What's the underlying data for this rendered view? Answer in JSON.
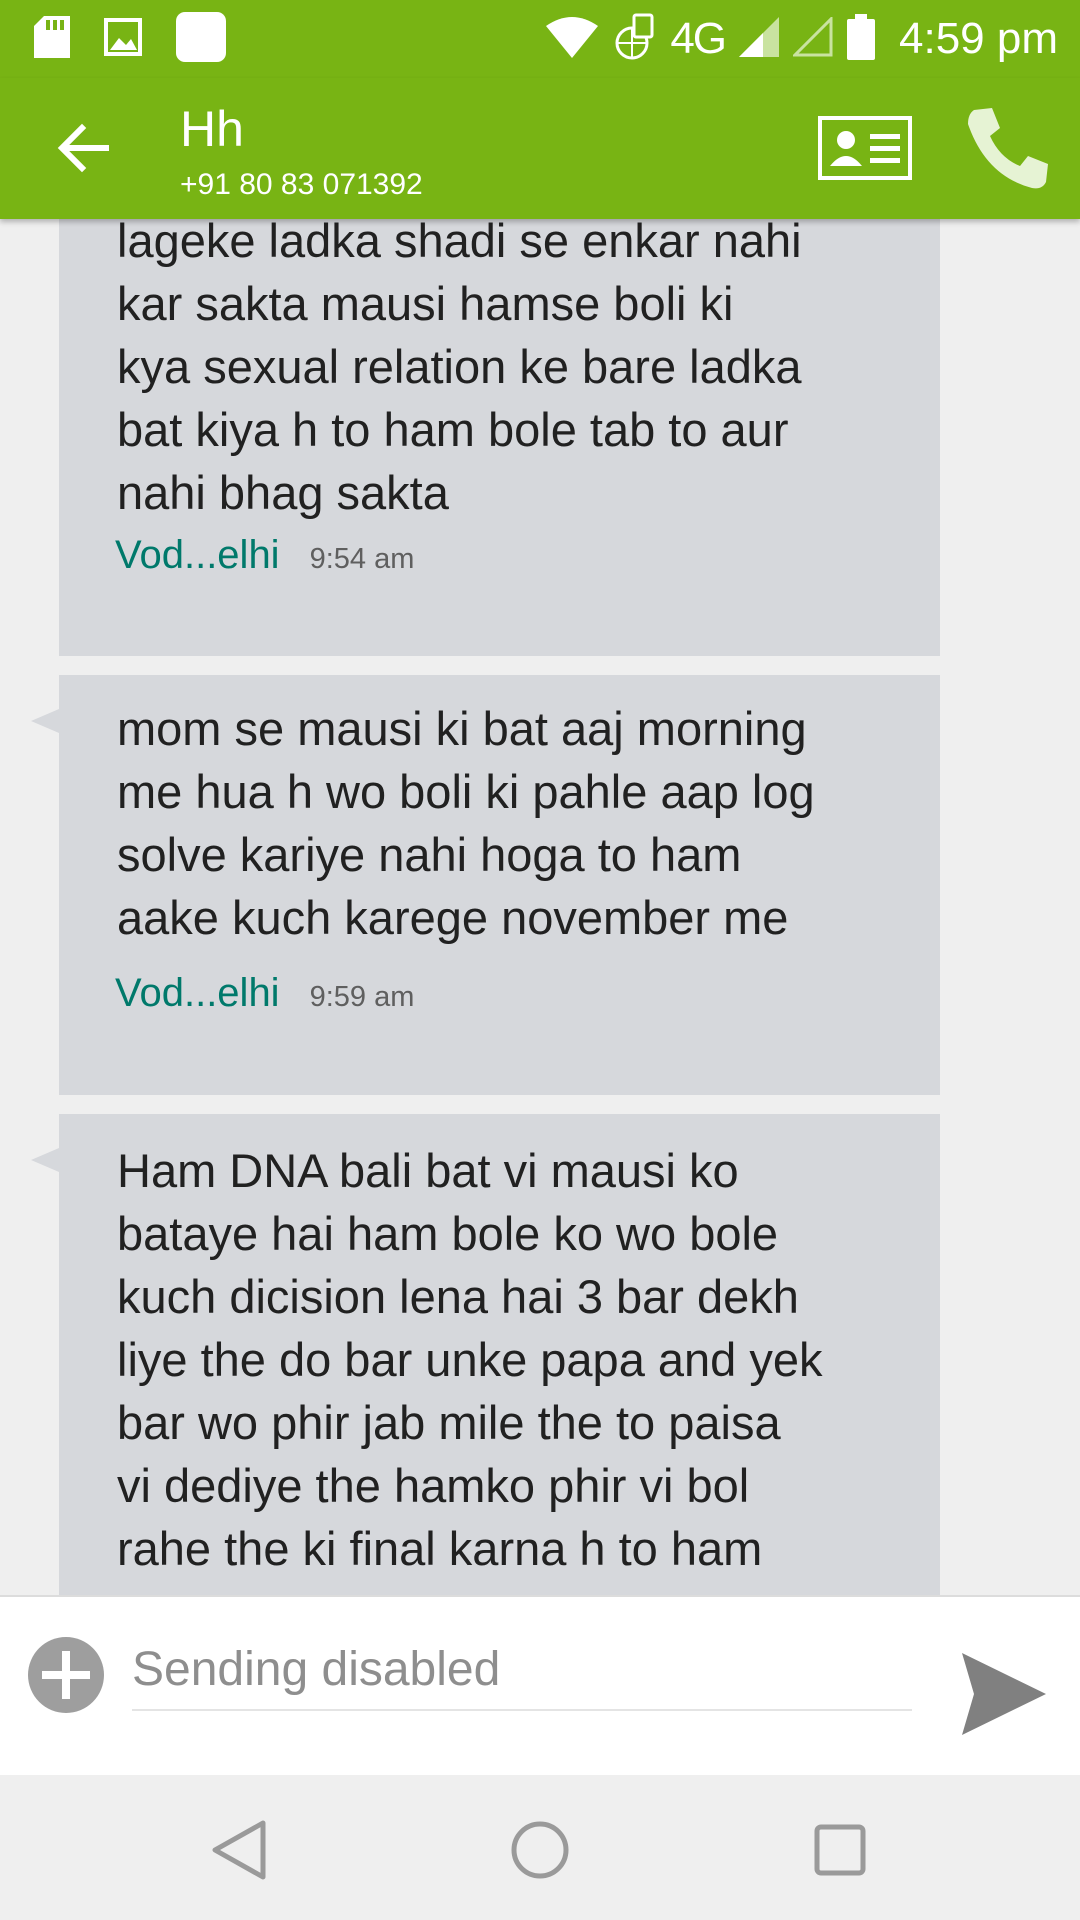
{
  "status_bar": {
    "time": "4:59 pm",
    "network": "4G",
    "icons": [
      "sd-card-icon",
      "image-icon",
      "square-notification-icon",
      "wifi-icon",
      "data-roaming-icon",
      "signal-icon",
      "signal-empty-icon",
      "battery-icon"
    ]
  },
  "app_bar": {
    "contact_name": "Hh",
    "contact_number": "+91 80 83 071392",
    "icons": [
      "back-arrow-icon",
      "contact-card-icon",
      "phone-icon"
    ]
  },
  "messages": [
    {
      "text": "lageke ladka shadi se enkar nahi\nkar sakta mausi hamse boli ki\nkya sexual relation ke bare ladka\nbat kiya h to ham bole tab to aur\nnahi bhag sakta",
      "carrier": "Vod...elhi",
      "time": "9:54 am"
    },
    {
      "text": "mom se mausi ki bat aaj morning\nme hua h wo boli ki pahle aap log\nsolve kariye nahi hoga to ham\naake kuch karege november me",
      "carrier": "Vod...elhi",
      "time": "9:59 am"
    },
    {
      "text": "Ham DNA bali bat vi mausi ko\nbataye hai ham bole ko wo bole\nkuch dicision lena hai 3 bar dekh\nliye the do bar unke papa and yek\nbar wo phir jab mile the to paisa\nvi dediye the hamko phir vi bol\nrahe the ki final karna h to ham",
      "carrier": "",
      "time": ""
    }
  ],
  "compose": {
    "placeholder": "Sending disabled",
    "icons": [
      "add-attachment-icon",
      "send-icon"
    ]
  },
  "nav_bar": {
    "icons": [
      "nav-back-icon",
      "nav-home-icon",
      "nav-recents-icon"
    ]
  },
  "colors": {
    "accent": "#78b414",
    "bubble": "#d6d8dc",
    "carrier_text": "#00796b"
  }
}
